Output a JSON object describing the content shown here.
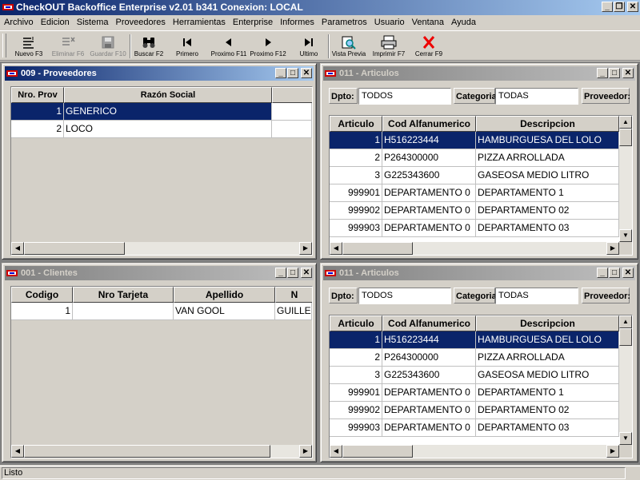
{
  "app": {
    "title": "CheckOUT Backoffice Enterprise v2.01 b341 Conexion: LOCAL"
  },
  "menu": [
    "Archivo",
    "Edicion",
    "Sistema",
    "Proveedores",
    "Herramientas",
    "Enterprise",
    "Informes",
    "Parametros",
    "Usuario",
    "Ventana",
    "Ayuda"
  ],
  "toolbar": {
    "nuevo": "Nuevo F3",
    "eliminar": "Eliminar F6",
    "guardar": "Guardar F10",
    "buscar": "Buscar F2",
    "primero": "Primero",
    "proximo_f11": "Proximo F11",
    "proximo_f12": "Proximo F12",
    "ultimo": "Ultimo",
    "vista_previa": "Vista Previa",
    "imprimir": "Imprimir F7",
    "cerrar": "Cerrar F9"
  },
  "proveedores": {
    "title": "009 - Proveedores",
    "columns": [
      "Nro. Prov",
      "Razón Social"
    ],
    "rows": [
      [
        "1",
        "GENERICO"
      ],
      [
        "2",
        "LOCO"
      ]
    ]
  },
  "clientes": {
    "title": "001 - Clientes",
    "columns": [
      "Codigo",
      "Nro Tarjeta",
      "Apellido",
      "N"
    ],
    "rows": [
      [
        "1",
        "",
        "VAN GOOL",
        "GUILLE"
      ]
    ]
  },
  "articulos_top": {
    "title": "011 - Articulos",
    "dpto_label": "Dpto:",
    "dpto_value": "TODOS",
    "categoria_label": "Categoria:",
    "categoria_value": "TODAS",
    "proveedor_label": "Proveedor:",
    "columns": [
      "Articulo",
      "Cod Alfanumerico",
      "Descripcion"
    ],
    "rows": [
      [
        "1",
        "H516223444",
        "HAMBURGUESA DEL LOLO"
      ],
      [
        "2",
        "P264300000",
        "PIZZA ARROLLADA"
      ],
      [
        "3",
        "G225343600",
        "GASEOSA MEDIO LITRO"
      ],
      [
        "999901",
        "DEPARTAMENTO 0",
        "DEPARTAMENTO 1"
      ],
      [
        "999902",
        "DEPARTAMENTO 0",
        "DEPARTAMENTO 02"
      ],
      [
        "999903",
        "DEPARTAMENTO 0",
        "DEPARTAMENTO 03"
      ]
    ]
  },
  "articulos_bottom": {
    "title": "011 - Articulos",
    "dpto_label": "Dpto:",
    "dpto_value": "TODOS",
    "categoria_label": "Categoria:",
    "categoria_value": "TODAS",
    "proveedor_label": "Proveedor:",
    "columns": [
      "Articulo",
      "Cod Alfanumerico",
      "Descripcion"
    ],
    "rows": [
      [
        "1",
        "H516223444",
        "HAMBURGUESA DEL LOLO"
      ],
      [
        "2",
        "P264300000",
        "PIZZA ARROLLADA"
      ],
      [
        "3",
        "G225343600",
        "GASEOSA MEDIO LITRO"
      ],
      [
        "999901",
        "DEPARTAMENTO 0",
        "DEPARTAMENTO 1"
      ],
      [
        "999902",
        "DEPARTAMENTO 0",
        "DEPARTAMENTO 02"
      ],
      [
        "999903",
        "DEPARTAMENTO 0",
        "DEPARTAMENTO 03"
      ]
    ]
  },
  "status": {
    "text": "Listo"
  },
  "colors": {
    "selection": "#0a246a",
    "face": "#d4d0c8",
    "mdi_bg": "#808080"
  }
}
